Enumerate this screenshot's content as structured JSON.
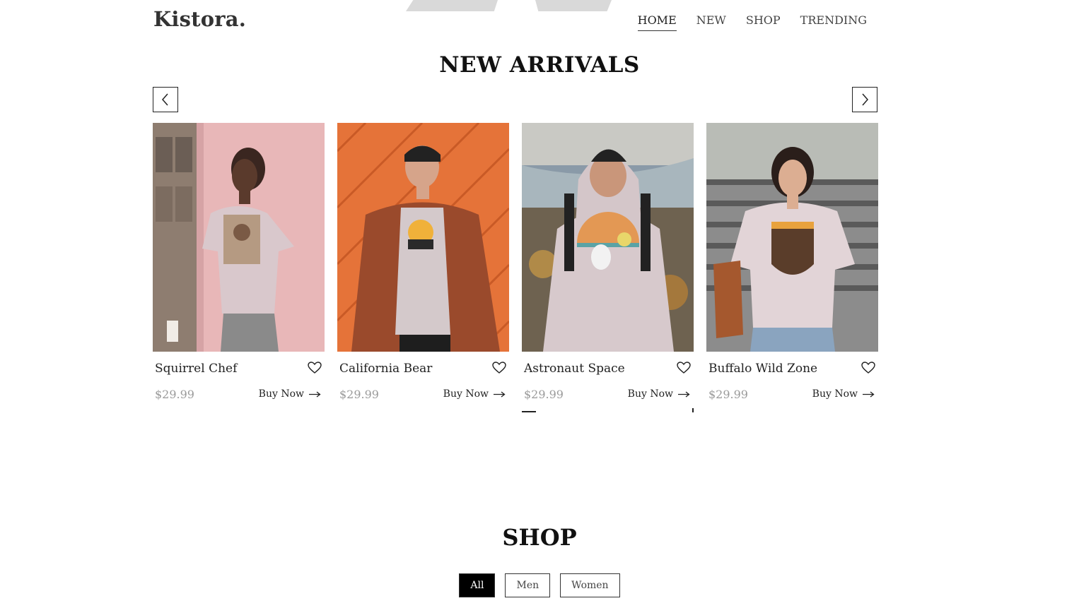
{
  "brand": {
    "name": "Kistora."
  },
  "nav": {
    "home": "HOME",
    "new": "NEW",
    "shop": "SHOP",
    "trending": "TRENDING"
  },
  "arrivals": {
    "title": "NEW ARRIVALS",
    "products": [
      {
        "name": "Squirrel Chef",
        "price": "$29.99",
        "buy": "Buy Now"
      },
      {
        "name": "California Bear",
        "price": "$29.99",
        "buy": "Buy Now"
      },
      {
        "name": "Astronaut Space",
        "price": "$29.99",
        "buy": "Buy Now"
      },
      {
        "name": "Buffalo Wild Zone",
        "price": "$29.99",
        "buy": "Buy Now"
      }
    ]
  },
  "shop": {
    "title": "SHOP",
    "filters": {
      "all": "All",
      "men": "Men",
      "women": "Women"
    },
    "active_filter": "All"
  },
  "colors": {
    "accent": "#000000",
    "price": "#9a9a9a",
    "card1_bg": "#e8b7b8",
    "card2_bg": "#e57339",
    "card3_bg": "#8a9aa8",
    "card4_bg": "#8c8c8c"
  }
}
